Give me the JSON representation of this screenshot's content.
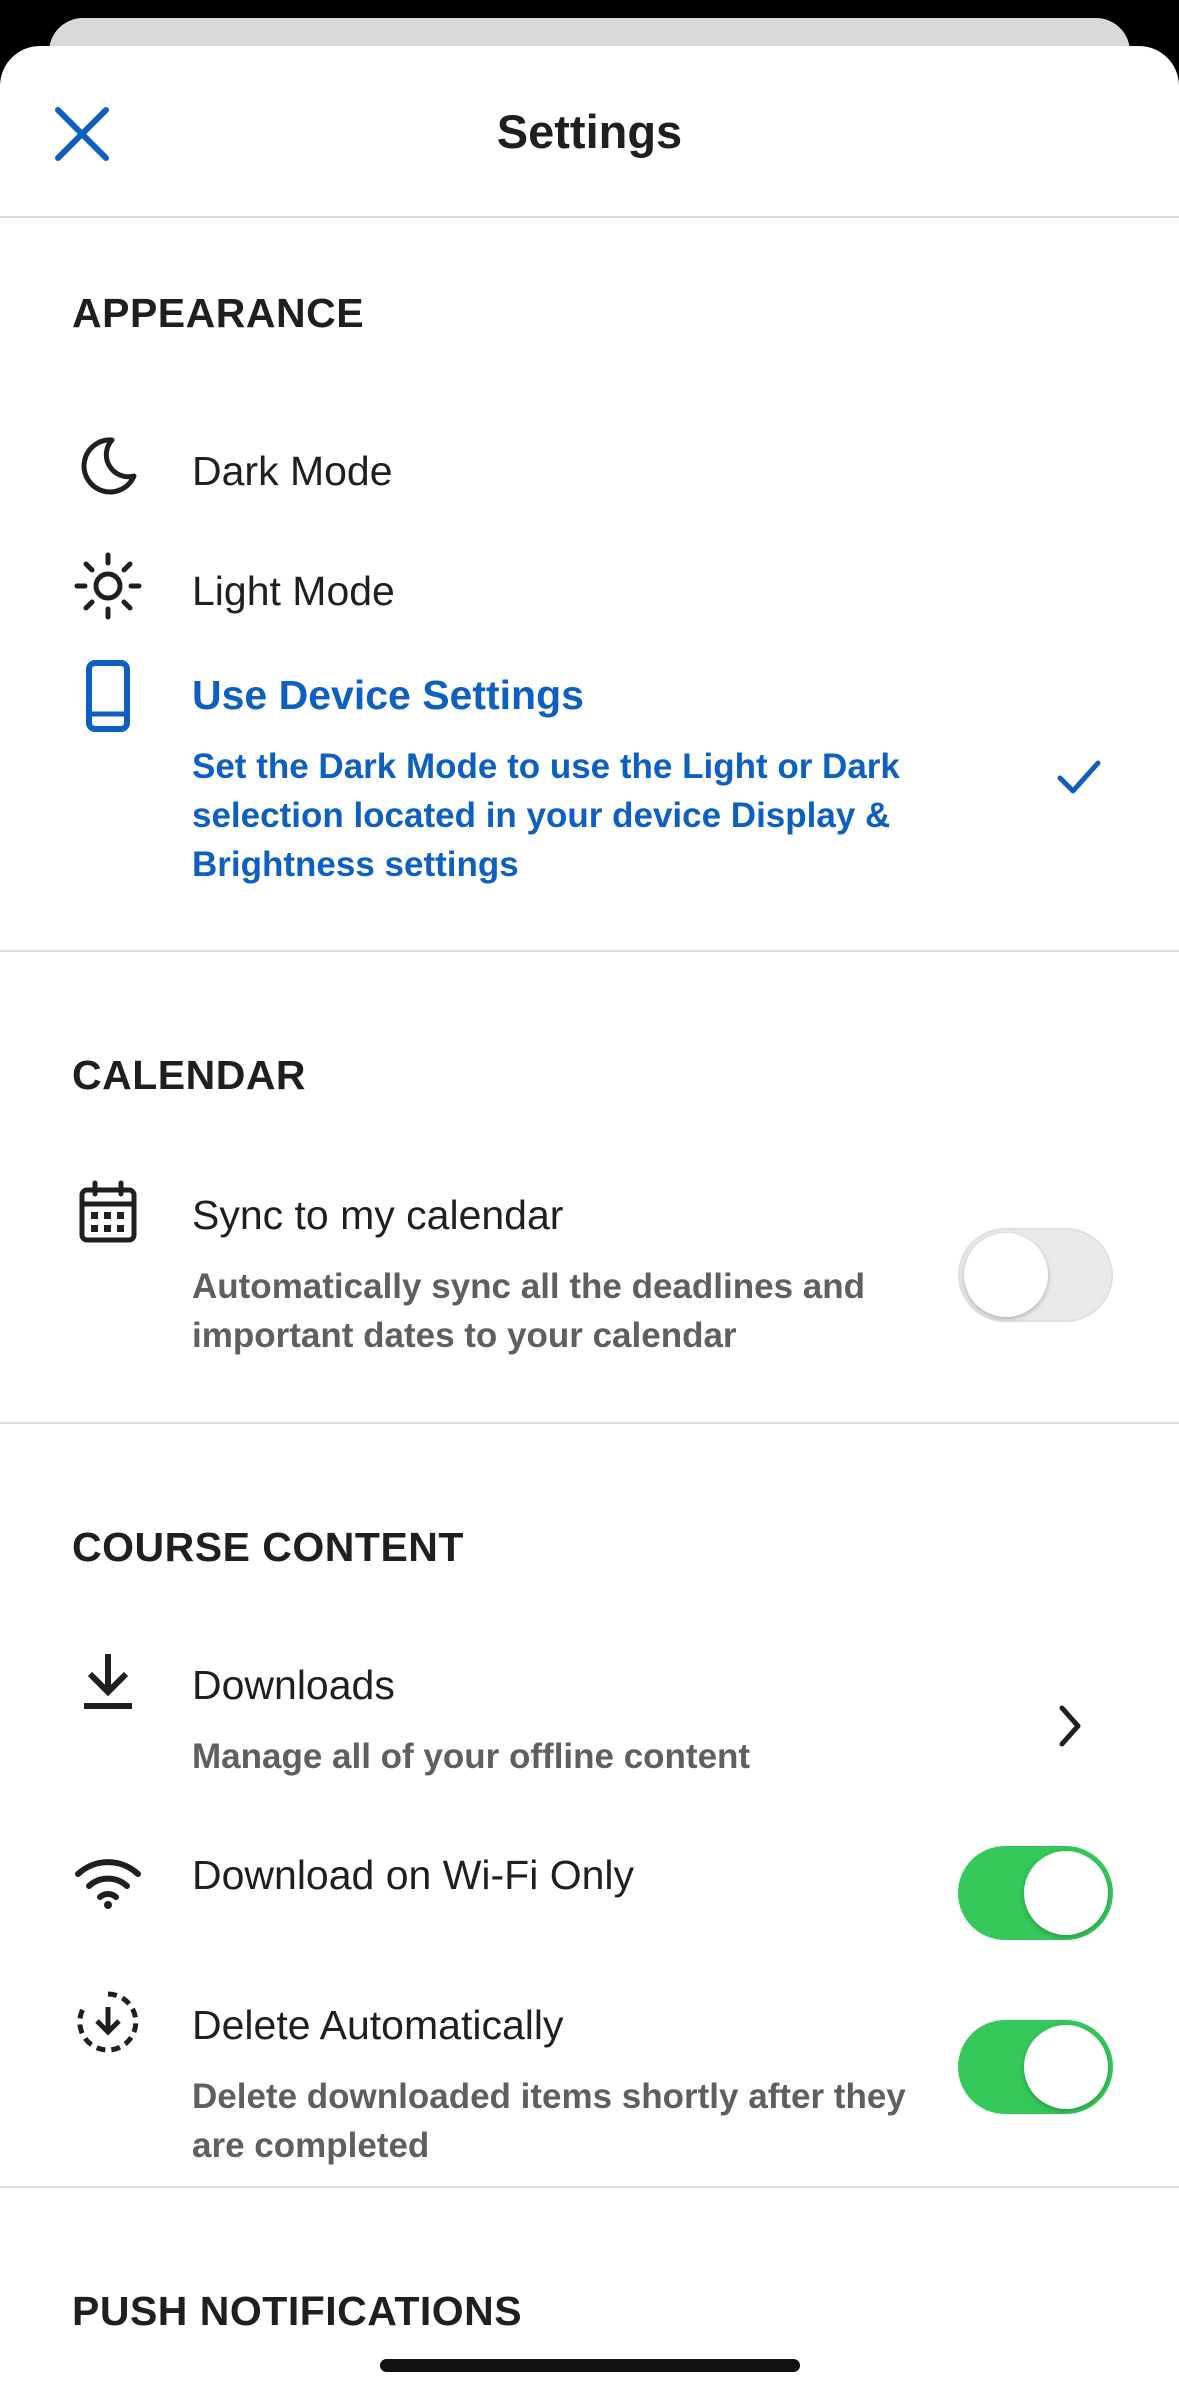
{
  "header": {
    "title": "Settings",
    "close_icon": "close-icon"
  },
  "colors": {
    "accent": "#0e5fc2",
    "toggle_on": "#34c759",
    "toggle_off": "#e9e9eb"
  },
  "appearance": {
    "title": "APPEARANCE",
    "dark_mode": {
      "label": "Dark Mode",
      "icon": "moon-icon"
    },
    "light_mode": {
      "label": "Light Mode",
      "icon": "sun-icon"
    },
    "device_settings": {
      "label": "Use Device Settings",
      "description": "Set the Dark Mode to use the Light or Dark selection located in your device Display & Brightness settings",
      "icon": "phone-icon",
      "selected": true
    }
  },
  "calendar": {
    "title": "CALENDAR",
    "sync": {
      "label": "Sync to my calendar",
      "description": "Automatically sync all the deadlines and important dates to your calendar",
      "icon": "calendar-icon",
      "enabled": false
    }
  },
  "course_content": {
    "title": "COURSE CONTENT",
    "downloads": {
      "label": "Downloads",
      "description": "Manage all of your offline content",
      "icon": "download-icon"
    },
    "wifi_only": {
      "label": "Download on Wi-Fi Only",
      "icon": "wifi-icon",
      "enabled": true
    },
    "delete_auto": {
      "label": "Delete Automatically",
      "description": "Delete downloaded items shortly after they are completed",
      "icon": "delete-download-icon",
      "enabled": true
    }
  },
  "push_notifications": {
    "title": "PUSH NOTIFICATIONS"
  }
}
